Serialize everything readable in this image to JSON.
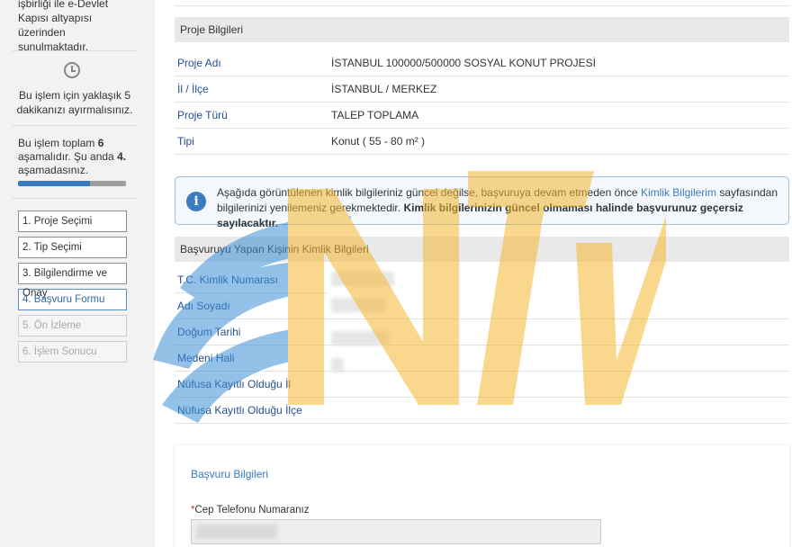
{
  "sidebar": {
    "intro_text": "işbirliği ile e-Devlet Kapısı altyapısı üzerinden sunulmaktadır.",
    "clock_icon": "clock-icon",
    "time_note": "Bu işlem için yaklaşık 5 dakikanızı ayırmalısınız.",
    "stage_prefix": "Bu işlem toplam",
    "stage_total": "6",
    "stage_mid": "aşamalıdır. Şu anda",
    "stage_current": "4.",
    "stage_suffix": "aşamadasınız.",
    "progress_fraction": 0.67,
    "steps": [
      {
        "label": "1. Proje Seçimi",
        "state": "done"
      },
      {
        "label": "2. Tip Seçimi",
        "state": "done"
      },
      {
        "label": "3. Bilgilendirme ve Onay",
        "state": "done"
      },
      {
        "label": "4. Başvuru Formu",
        "state": "active"
      },
      {
        "label": "5. Ön İzleme",
        "state": "disabled"
      },
      {
        "label": "6. İşlem Sonucu",
        "state": "disabled"
      }
    ]
  },
  "project": {
    "heading": "Proje Bilgileri",
    "rows": [
      {
        "label": "Proje Adı",
        "value": "İSTANBUL 100000/500000 SOSYAL KONUT PROJESİ"
      },
      {
        "label": "İl / İlçe",
        "value": "İSTANBUL / MERKEZ"
      },
      {
        "label": "Proje Türü",
        "value": "TALEP TOPLAMA"
      },
      {
        "label": "Tipi",
        "value": "Konut ( 55 - 80 m² )"
      }
    ]
  },
  "info": {
    "icon": "info-icon",
    "text_1": "Aşağıda görüntülenen kimlik bilgileriniz güncel değilse, başvuruya devam etmeden önce",
    "link": "Kimlik Bilgilerim",
    "text_2": "sayfasından bilgilerinizi yenilemeniz gerekmektedir.",
    "bold": "Kimlik bilgilerinizin güncel olmaması halinde başvurunuz geçersiz sayılacaktır."
  },
  "identity": {
    "heading": "Başvuruyu Yapan Kişinin Kimlik Bilgileri",
    "rows": [
      {
        "label": "T.C. Kimlik Numarası"
      },
      {
        "label": "Adı Soyadı"
      },
      {
        "label": "Doğum Tarihi"
      },
      {
        "label": "Medeni Hali"
      },
      {
        "label": "Nüfusa Kayıtlı Olduğu İl"
      },
      {
        "label": "Nüfusa Kayıtlı Olduğu İlçe"
      }
    ]
  },
  "application": {
    "heading": "Başvuru Bilgileri",
    "phone_label": "Cep Telefonu Numaranız",
    "required_mark": "*"
  },
  "watermark": {
    "text": "NTV",
    "colors": [
      "#3d8fd6",
      "#f5b731"
    ]
  }
}
